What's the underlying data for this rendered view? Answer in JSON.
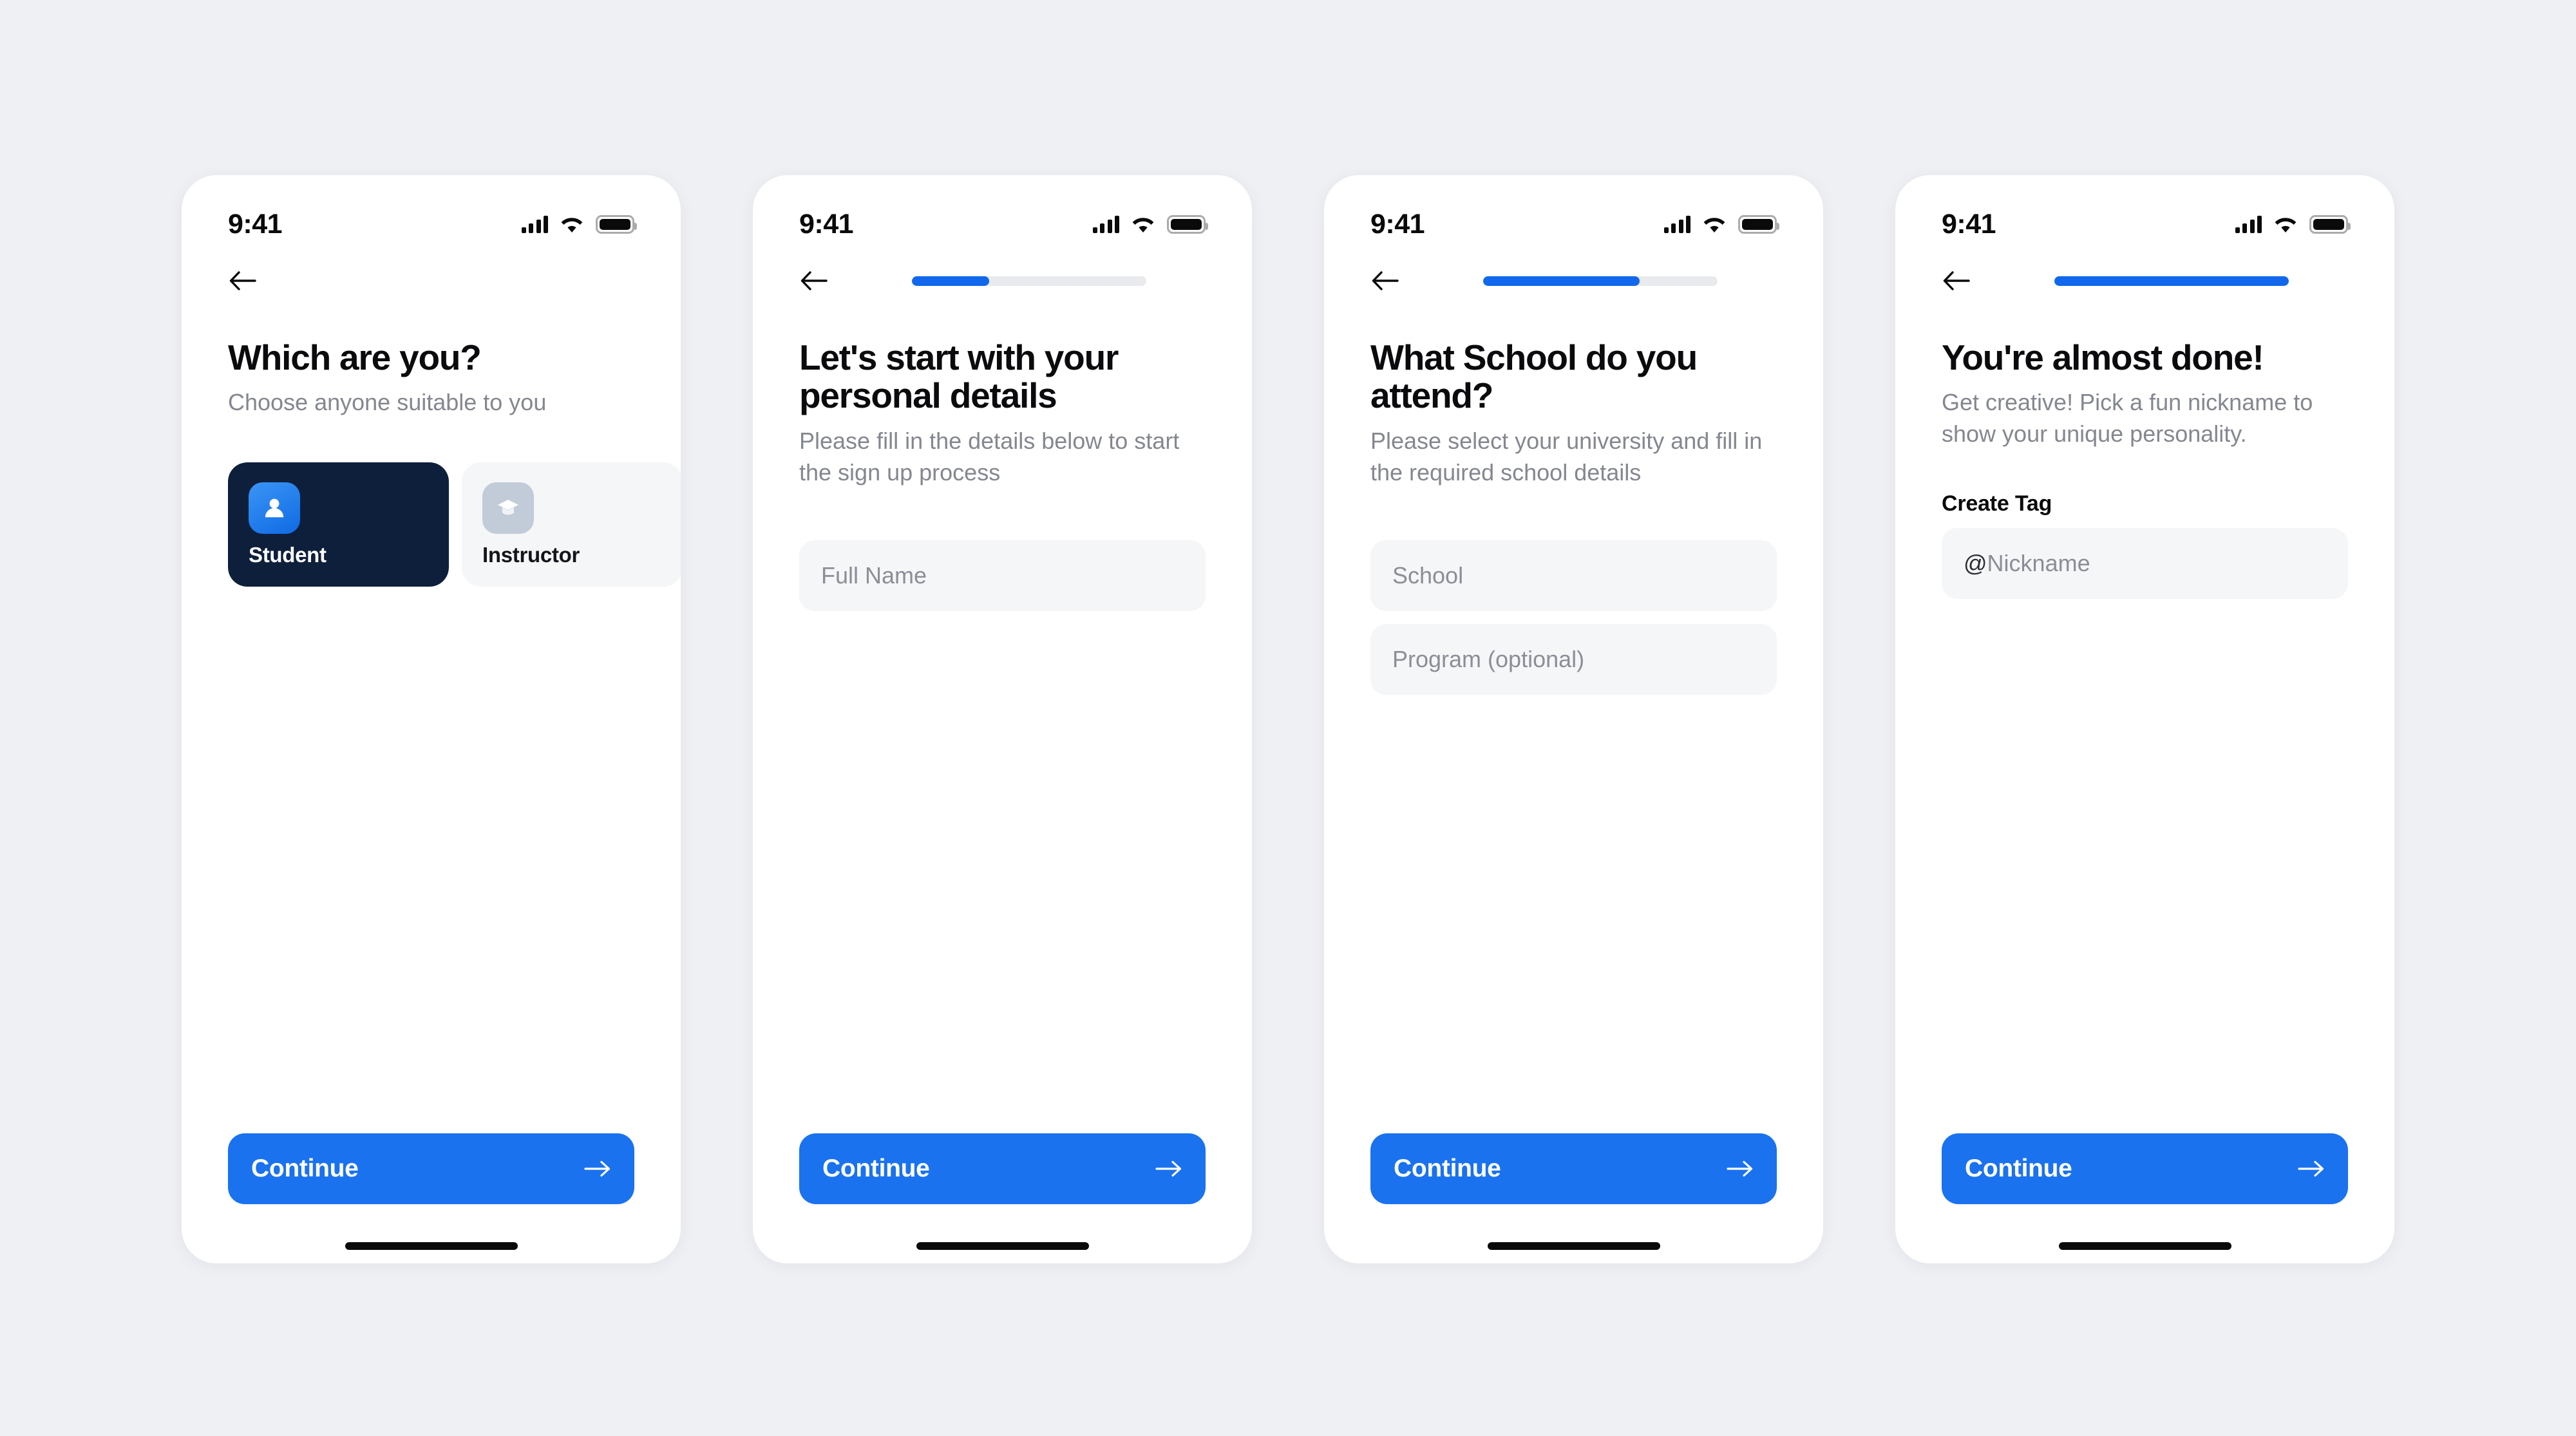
{
  "theme": {
    "page_background": "#eff0f4",
    "accent_blue": "#1a72ef",
    "progress_blue": "#1168ec",
    "selected_card": "#0e1f3c",
    "unselected_card": "#f5f6f8",
    "input_background": "#f5f6f8",
    "title_color": "#0b0b0e",
    "subtitle_color": "#84878f",
    "placeholder_color": "#8b8e96"
  },
  "status_bar": {
    "time": "9:41",
    "cellular_icon": "signal-bars-icon",
    "wifi_icon": "wifi-icon",
    "battery_icon": "battery-full-icon"
  },
  "icons": {
    "back": "arrow-left-icon",
    "forward": "arrow-right-icon",
    "student": "person-icon",
    "instructor": "graduation-cap-icon"
  },
  "cta": {
    "label": "Continue"
  },
  "screens": [
    {
      "id": "role-select",
      "show_progress": false,
      "progress_percent": 0,
      "title": "Which are you?",
      "subtitle": "Choose anyone suitable to you",
      "roles": [
        {
          "label": "Student",
          "icon": "person-icon",
          "selected": true
        },
        {
          "label": "Instructor",
          "icon": "graduation-cap-icon",
          "selected": false
        }
      ]
    },
    {
      "id": "personal-details",
      "show_progress": true,
      "progress_percent": 33,
      "title": "Let's start with your personal details",
      "subtitle": "Please fill in the details below to start the sign up process",
      "fields": [
        {
          "name": "full-name",
          "placeholder": "Full Name",
          "value": "",
          "prefix": ""
        }
      ]
    },
    {
      "id": "school-details",
      "show_progress": true,
      "progress_percent": 67,
      "title": "What School do you attend?",
      "subtitle": "Please select your university and fill in the required school details",
      "fields": [
        {
          "name": "school",
          "placeholder": "School",
          "value": "",
          "prefix": ""
        },
        {
          "name": "program",
          "placeholder": "Program (optional)",
          "value": "",
          "prefix": ""
        }
      ]
    },
    {
      "id": "create-tag",
      "show_progress": true,
      "progress_percent": 100,
      "title": "You're almost done!",
      "subtitle": "Get creative! Pick a fun nickname to show your unique personality.",
      "field_label": "Create Tag",
      "fields": [
        {
          "name": "nickname",
          "placeholder": "Nickname",
          "value": "",
          "prefix": "@"
        }
      ]
    }
  ]
}
